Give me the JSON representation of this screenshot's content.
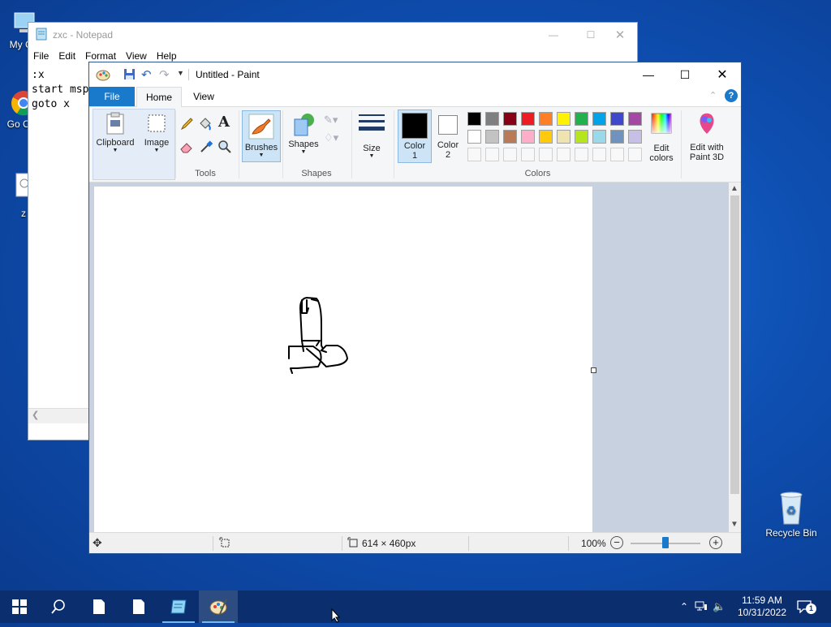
{
  "desktop": {
    "icons": [
      {
        "label": "My Co"
      },
      {
        "label": "Go Chr"
      },
      {
        "label": "z"
      },
      {
        "label": "Recycle Bin"
      }
    ]
  },
  "notepad": {
    "title": "zxc - Notepad",
    "menu": [
      "File",
      "Edit",
      "Format",
      "View",
      "Help"
    ],
    "lines": [
      ":x",
      "start msp",
      "goto x"
    ]
  },
  "paint": {
    "title": "Untitled - Paint",
    "tabs": {
      "file": "File",
      "home": "Home",
      "view": "View"
    },
    "ribbon": {
      "clipboard": "Clipboard",
      "image": "Image",
      "tools": "Tools",
      "brushes": "Brushes",
      "shapes_btn": "Shapes",
      "shapes_group": "Shapes",
      "size": "Size",
      "color1": "Color\n1",
      "color1_l1": "Color",
      "color1_l2": "1",
      "color2_l1": "Color",
      "color2_l2": "2",
      "edit_colors_l1": "Edit",
      "edit_colors_l2": "colors",
      "paint3d_l1": "Edit with",
      "paint3d_l2": "Paint 3D",
      "colors_group": "Colors"
    },
    "palette_row1": [
      "#000000",
      "#7f7f7f",
      "#880015",
      "#ed1c24",
      "#ff7f27",
      "#fff200",
      "#22b14c",
      "#00a2e8",
      "#3f48cc",
      "#a349a4"
    ],
    "palette_row2": [
      "#ffffff",
      "#c3c3c3",
      "#b97a57",
      "#ffaec9",
      "#ffc90e",
      "#efe4b0",
      "#b5e61d",
      "#99d9ea",
      "#7092be",
      "#c8bfe7"
    ],
    "color1": "#000000",
    "color2": "#ffffff",
    "status": {
      "dimensions": "614 × 460px",
      "zoom": "100%",
      "zoom_level": 0.5
    }
  },
  "taskbar": {
    "time": "11:59 AM",
    "date": "10/31/2022",
    "notification_count": "1"
  }
}
